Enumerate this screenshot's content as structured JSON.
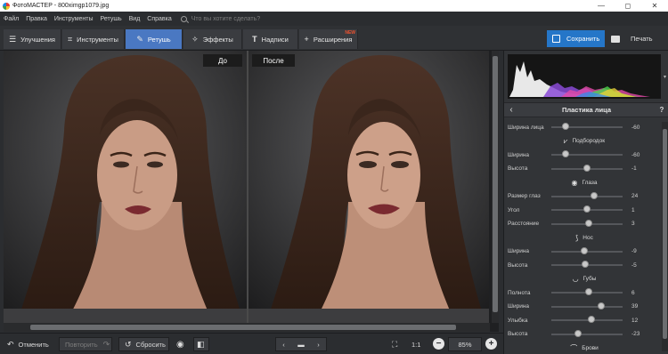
{
  "window": {
    "title": "ФотоМАСТЕР - 800ximgp1079.jpg",
    "controls": [
      "—",
      "◻",
      "✕"
    ]
  },
  "menu": {
    "items": [
      "Файл",
      "Правка",
      "Инструменты",
      "Ретушь",
      "Вид",
      "Справка"
    ],
    "search_placeholder": "Что вы хотите сделать?"
  },
  "tabs": [
    {
      "label": "Улучшения",
      "icon": "sliders-icon",
      "active": false
    },
    {
      "label": "Инструменты",
      "icon": "crop-icon",
      "active": false
    },
    {
      "label": "Ретушь",
      "icon": "brush-icon",
      "active": true
    },
    {
      "label": "Эффекты",
      "icon": "magic-wand-icon",
      "active": false
    },
    {
      "label": "Надписи",
      "icon": "text-icon",
      "active": false
    },
    {
      "label": "Расширения",
      "icon": "plus-icon",
      "active": false,
      "badge": "NEW"
    }
  ],
  "actions": {
    "save_label": "Сохранить",
    "print_label": "Печать"
  },
  "viewer": {
    "before_label": "До",
    "after_label": "После"
  },
  "bottom": {
    "undo_label": "Отменить",
    "redo_label": "Повторить",
    "reset_label": "Сбросить",
    "ratio_label": "1:1",
    "zoom": "85%"
  },
  "panel": {
    "title": "Пластика лица",
    "help": "?",
    "groups": [
      {
        "type": "slider",
        "label": "Ширина лица",
        "value": "-60",
        "level": 0.2
      },
      {
        "type": "group",
        "label": "Подбородок",
        "icon": "chin-icon"
      },
      {
        "type": "slider",
        "label": "Ширина",
        "value": "-60",
        "level": 0.2
      },
      {
        "type": "slider",
        "label": "Высота",
        "value": "-1",
        "level": 0.5
      },
      {
        "type": "group",
        "label": "Глаза",
        "icon": "eye-icon"
      },
      {
        "type": "slider",
        "label": "Размер глаз",
        "value": "24",
        "level": 0.6
      },
      {
        "type": "slider",
        "label": "Угол",
        "value": "1",
        "level": 0.5
      },
      {
        "type": "slider",
        "label": "Расстояние",
        "value": "3",
        "level": 0.52
      },
      {
        "type": "group",
        "label": "Нос",
        "icon": "nose-icon"
      },
      {
        "type": "slider",
        "label": "Ширина",
        "value": "-9",
        "level": 0.46
      },
      {
        "type": "slider",
        "label": "Высота",
        "value": "-5",
        "level": 0.48
      },
      {
        "type": "group",
        "label": "Губы",
        "icon": "lips-icon"
      },
      {
        "type": "slider",
        "label": "Полнота",
        "value": "6",
        "level": 0.52
      },
      {
        "type": "slider",
        "label": "Ширина",
        "value": "39",
        "level": 0.7
      },
      {
        "type": "slider",
        "label": "Улыбка",
        "value": "12",
        "level": 0.56
      },
      {
        "type": "slider",
        "label": "Высота",
        "value": "-23",
        "level": 0.38
      },
      {
        "type": "group",
        "label": "Брови",
        "icon": "brow-icon"
      }
    ]
  },
  "colors": {
    "accent": "#2576c8",
    "active_tab": "#4a78c2",
    "new_badge": "#f0522f"
  }
}
